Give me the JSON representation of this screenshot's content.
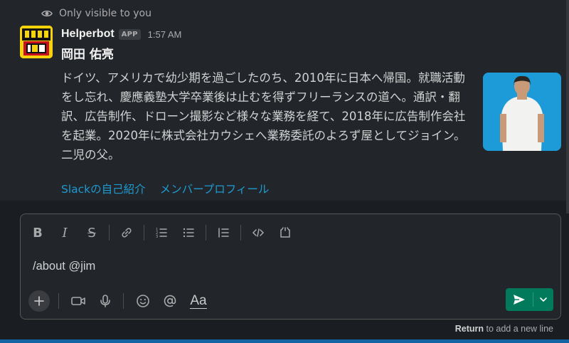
{
  "message": {
    "visibility_text": "Only visible to you",
    "sender": "Helperbot",
    "badge": "APP",
    "time": "1:57 AM",
    "person_name": "岡田 佑亮",
    "bio": "ドイツ、アメリカで幼少期を過ごしたのち、2010年に日本へ帰国。就職活動をし忘れ、慶應義塾大学卒業後は止むを得ずフリーランスの道へ。通訳・翻訳、広告制作、ドローン撮影など様々な業務を経て、2018年に広告制作会社を起業。2020年に株式会社カウシェへ業務委託のよろず屋としてジョイン。二児の父。",
    "links": [
      "Slackの自己紹介",
      "メンバープロフィール"
    ]
  },
  "composer": {
    "input_value": "/about @jim",
    "format_label": "Aa",
    "hint_key": "Return",
    "hint_text": " to add a new line"
  },
  "colors": {
    "background": "#1a1d21",
    "message_bg": "#222529",
    "link": "#1d9bd1",
    "send": "#007a5a",
    "photo_bg": "#1d9bd8",
    "avatar_bg": "#f5d20a"
  },
  "icons": [
    "eye-icon",
    "bold-icon",
    "italic-icon",
    "strikethrough-icon",
    "link-icon",
    "ordered-list-icon",
    "bulleted-list-icon",
    "blockquote-icon",
    "code-icon",
    "code-block-icon",
    "plus-icon",
    "video-icon",
    "microphone-icon",
    "emoji-icon",
    "mention-icon",
    "send-icon",
    "chevron-down-icon"
  ]
}
